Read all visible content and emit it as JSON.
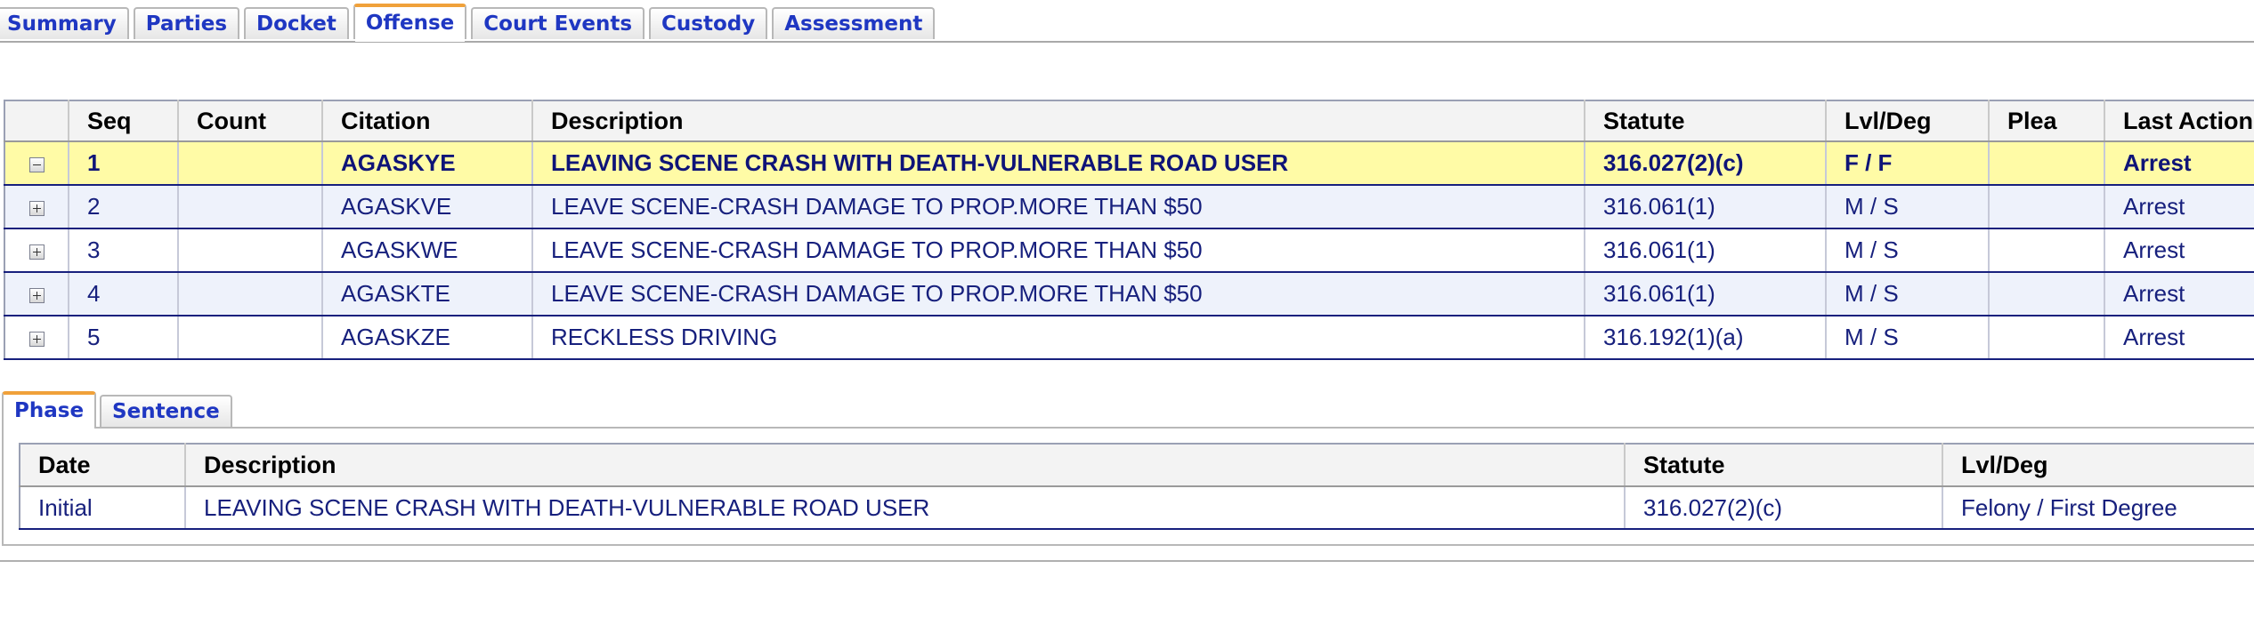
{
  "tabs": [
    {
      "label": "Summary",
      "active": false
    },
    {
      "label": "Parties",
      "active": false
    },
    {
      "label": "Docket",
      "active": false
    },
    {
      "label": "Offense",
      "active": true
    },
    {
      "label": "Court Events",
      "active": false
    },
    {
      "label": "Custody",
      "active": false
    },
    {
      "label": "Assessment",
      "active": false
    }
  ],
  "offense_table": {
    "headers": {
      "seq": "Seq",
      "count": "Count",
      "citation": "Citation",
      "description": "Description",
      "statute": "Statute",
      "lvl_deg": "Lvl/Deg",
      "plea": "Plea",
      "last_action": "Last Action"
    },
    "rows": [
      {
        "seq": "1",
        "count": "",
        "citation": "AGASKYE",
        "description": "LEAVING SCENE CRASH WITH DEATH-VULNERABLE ROAD USER",
        "statute": "316.027(2)(c)",
        "lvl_deg": "F / F",
        "plea": "",
        "last_action": "Arrest",
        "expanded": true,
        "selected": true
      },
      {
        "seq": "2",
        "count": "",
        "citation": "AGASKVE",
        "description": "LEAVE SCENE-CRASH DAMAGE TO PROP.MORE THAN $50",
        "statute": "316.061(1)",
        "lvl_deg": "M / S",
        "plea": "",
        "last_action": "Arrest",
        "expanded": false,
        "selected": false
      },
      {
        "seq": "3",
        "count": "",
        "citation": "AGASKWE",
        "description": "LEAVE SCENE-CRASH DAMAGE TO PROP.MORE THAN $50",
        "statute": "316.061(1)",
        "lvl_deg": "M / S",
        "plea": "",
        "last_action": "Arrest",
        "expanded": false,
        "selected": false
      },
      {
        "seq": "4",
        "count": "",
        "citation": "AGASKTE",
        "description": "LEAVE SCENE-CRASH DAMAGE TO PROP.MORE THAN $50",
        "statute": "316.061(1)",
        "lvl_deg": "M / S",
        "plea": "",
        "last_action": "Arrest",
        "expanded": false,
        "selected": false
      },
      {
        "seq": "5",
        "count": "",
        "citation": "AGASKZE",
        "description": "RECKLESS DRIVING",
        "statute": "316.192(1)(a)",
        "lvl_deg": "M / S",
        "plea": "",
        "last_action": "Arrest",
        "expanded": false,
        "selected": false
      }
    ]
  },
  "sub_tabs": [
    {
      "label": "Phase",
      "active": true
    },
    {
      "label": "Sentence",
      "active": false
    }
  ],
  "phase_table": {
    "headers": {
      "date": "Date",
      "description": "Description",
      "statute": "Statute",
      "lvl_deg": "Lvl/Deg"
    },
    "rows": [
      {
        "date": "Initial",
        "description": "LEAVING SCENE CRASH WITH DEATH-VULNERABLE ROAD USER",
        "statute": "316.027(2)(c)",
        "lvl_deg": "Felony / First Degree"
      }
    ]
  },
  "colors": {
    "link_blue": "#1f37c2",
    "row_text": "#17207d",
    "selected_row": "#fffba6",
    "alt_row": "#eef2fb",
    "active_tab_accent": "#f0a13a"
  }
}
